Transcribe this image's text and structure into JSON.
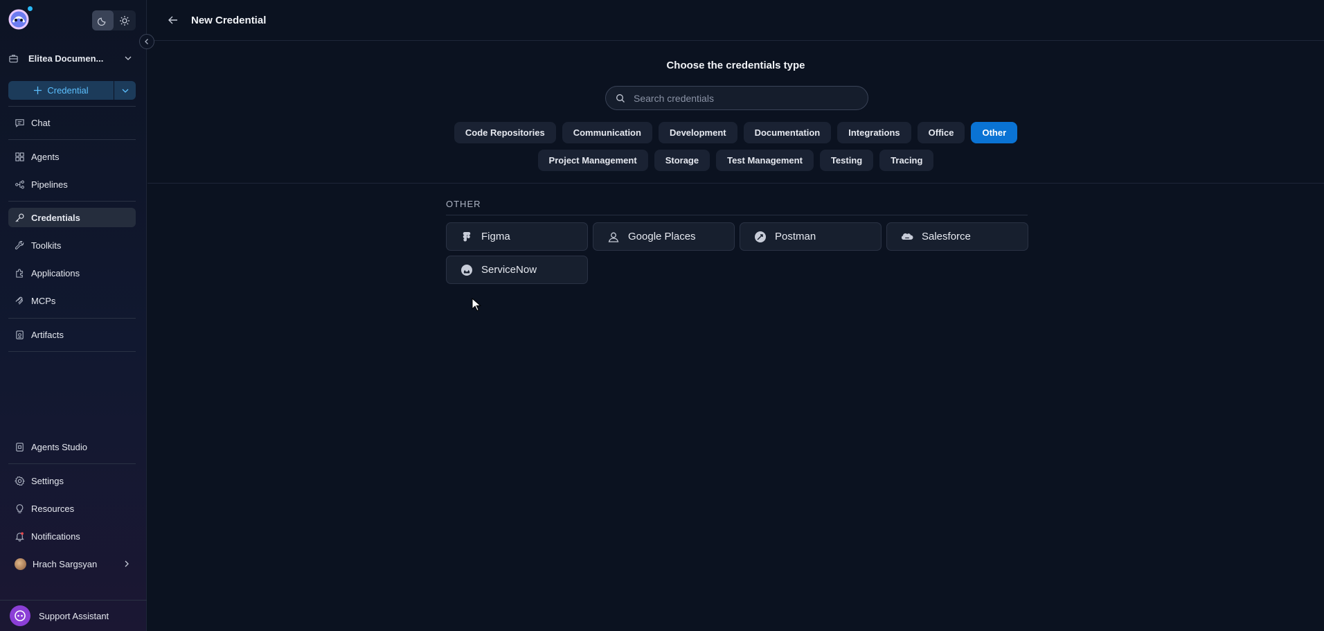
{
  "sidebar": {
    "project": "Elitea Documen...",
    "create_label": "Credential",
    "nav": [
      {
        "label": "Chat",
        "icon": "chat-icon"
      },
      {
        "label": "Agents",
        "icon": "grid-icon"
      },
      {
        "label": "Pipelines",
        "icon": "pipeline-icon"
      },
      {
        "label": "Credentials",
        "icon": "key-icon"
      },
      {
        "label": "Toolkits",
        "icon": "wrench-icon"
      },
      {
        "label": "Applications",
        "icon": "puzzle-icon"
      },
      {
        "label": "MCPs",
        "icon": "mcp-icon"
      },
      {
        "label": "Artifacts",
        "icon": "artifact-icon"
      }
    ],
    "bottom_nav": [
      {
        "label": "Agents Studio",
        "icon": "studio-icon"
      },
      {
        "label": "Settings",
        "icon": "gear-icon"
      },
      {
        "label": "Resources",
        "icon": "bulb-icon"
      },
      {
        "label": "Notifications",
        "icon": "bell-icon"
      }
    ],
    "user_name": "Hrach Sargsyan",
    "support_label": "Support Assistant"
  },
  "header": {
    "title": "New Credential"
  },
  "main": {
    "choose_title": "Choose the credentials type",
    "search_placeholder": "Search credentials",
    "categories_row1": [
      "Code Repositories",
      "Communication",
      "Development",
      "Documentation",
      "Integrations",
      "Office",
      "Other"
    ],
    "categories_row2": [
      "Project Management",
      "Storage",
      "Test Management",
      "Testing",
      "Tracing"
    ],
    "active_category": "Other",
    "section_label": "OTHER",
    "credentials": [
      {
        "label": "Figma",
        "icon": "figma-icon"
      },
      {
        "label": "Google Places",
        "icon": "user-icon"
      },
      {
        "label": "Postman",
        "icon": "postman-icon"
      },
      {
        "label": "Salesforce",
        "icon": "salesforce-icon"
      },
      {
        "label": "ServiceNow",
        "icon": "servicenow-icon"
      }
    ]
  },
  "colors": {
    "accent": "#0a73d4",
    "background": "#0b1220",
    "chip": "#1a2233"
  }
}
